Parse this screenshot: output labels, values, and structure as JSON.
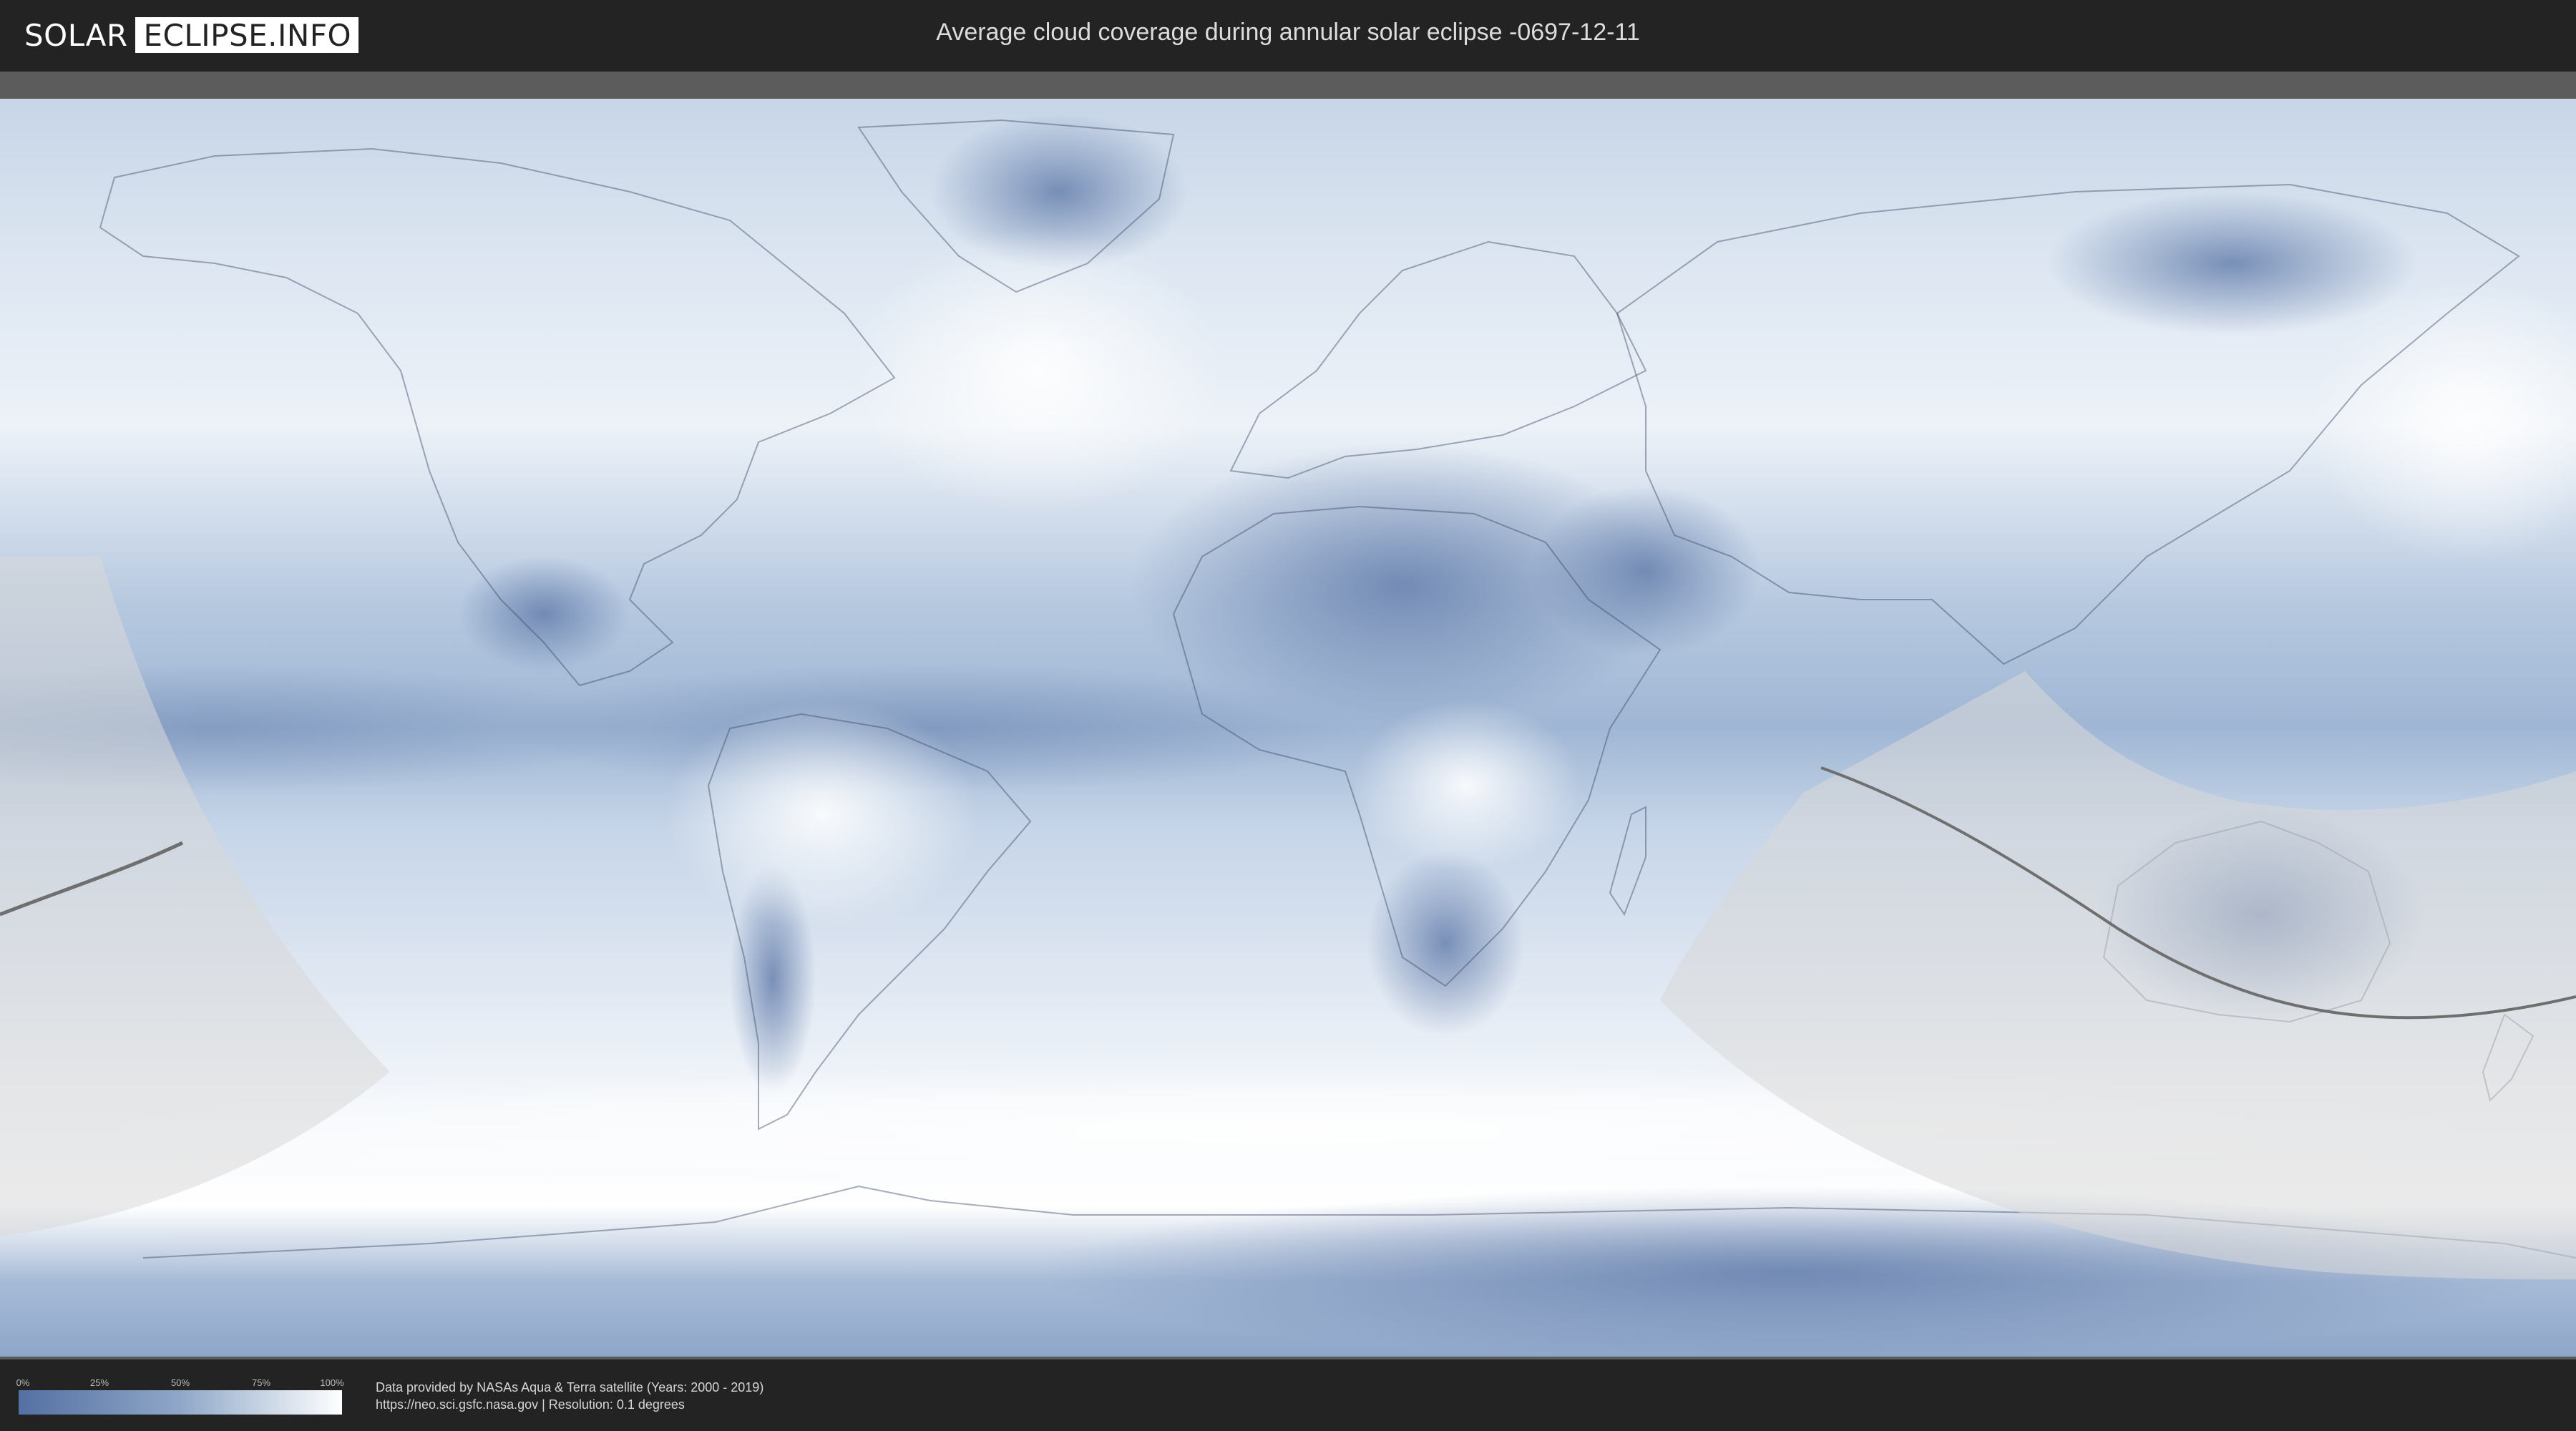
{
  "header": {
    "logo_part1": "SOLAR",
    "logo_part2": "ECLIPSE.INFO",
    "title": "Average cloud coverage during annular solar eclipse -0697-12-11"
  },
  "map": {
    "colors": {
      "cloud_low": "#5470a3",
      "cloud_mid": "#8fa7c8",
      "cloud_high": "#ffffff",
      "eclipse_shade": "#d8d8d8",
      "path_line": "#6f6f6f",
      "border": "#3b4a66"
    }
  },
  "legend": {
    "ticks": [
      "0%",
      "25%",
      "50%",
      "75%",
      "100%"
    ]
  },
  "credits": {
    "line1": "Data provided by NASAs Aqua & Terra satellite (Years: 2000 - 2019)",
    "line2": "https://neo.sci.gsfc.nasa.gov | Resolution: 0.1 degrees"
  }
}
